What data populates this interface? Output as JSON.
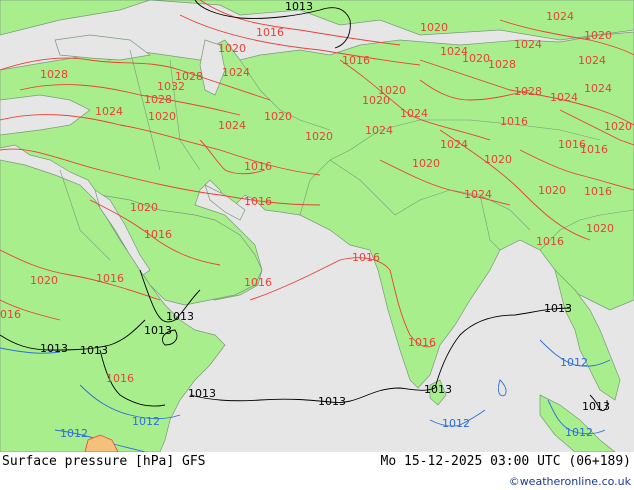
{
  "map": {
    "colors": {
      "land": "#a8ee8c",
      "sea": "#e6e6e6",
      "borders": "#7a9a7a",
      "isobar_high": "#e8413a",
      "isobar_mid": "#000000",
      "isobar_low": "#2f6fd6",
      "low_fill": "#f4c07a"
    },
    "labels_red": [
      "1020",
      "1016",
      "1020",
      "1028",
      "1028",
      "1032",
      "1024",
      "1028",
      "1024",
      "1020",
      "1024",
      "1020",
      "1020",
      "1024",
      "1016",
      "1020",
      "1016",
      "1016",
      "1016",
      "1020",
      "1016",
      "1016",
      "1016",
      "1016",
      "1016",
      "1024",
      "1020",
      "1024",
      "1028",
      "1024",
      "1028",
      "1020",
      "1024",
      "1020",
      "1024",
      "1024",
      "1024",
      "1020",
      "1020",
      "1016",
      "1016",
      "1016",
      "1020",
      "1024",
      "1020",
      "1024",
      "1016",
      "1020",
      "1016",
      "1020",
      "016"
    ],
    "labels_black": [
      "1013",
      "1013",
      "1013",
      "1013",
      "1013",
      "1013",
      "1013",
      "1013",
      "1013",
      "1013"
    ],
    "labels_blue": [
      "1012",
      "1012",
      "1012",
      "1012",
      "1012"
    ]
  },
  "footer": {
    "title": "Surface pressure [hPa] GFS",
    "valid_time": "Mo 15-12-2025 03:00 UTC (06+189)",
    "credit": "©weatheronline.co.uk"
  }
}
